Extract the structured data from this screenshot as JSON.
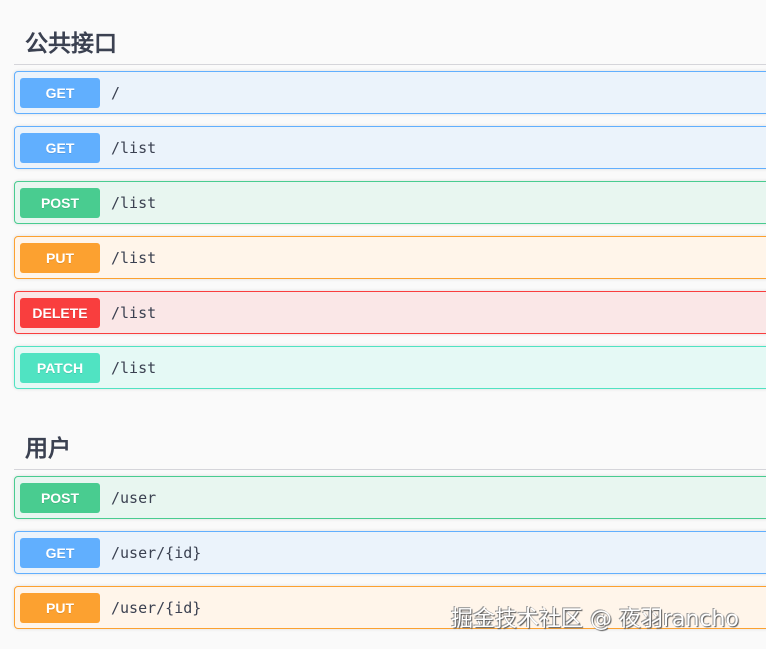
{
  "sections": [
    {
      "title": "公共接口",
      "operations": [
        {
          "method": "GET",
          "cls": "get",
          "path": "/"
        },
        {
          "method": "GET",
          "cls": "get",
          "path": "/list"
        },
        {
          "method": "POST",
          "cls": "post",
          "path": "/list"
        },
        {
          "method": "PUT",
          "cls": "put",
          "path": "/list"
        },
        {
          "method": "DELETE",
          "cls": "delete",
          "path": "/list"
        },
        {
          "method": "PATCH",
          "cls": "patch",
          "path": "/list"
        }
      ]
    },
    {
      "title": "用户",
      "operations": [
        {
          "method": "POST",
          "cls": "post",
          "path": "/user"
        },
        {
          "method": "GET",
          "cls": "get",
          "path": "/user/{id}"
        },
        {
          "method": "PUT",
          "cls": "put",
          "path": "/user/{id}"
        }
      ]
    }
  ],
  "watermark": "掘金技术社区 @ 夜羽rancho"
}
